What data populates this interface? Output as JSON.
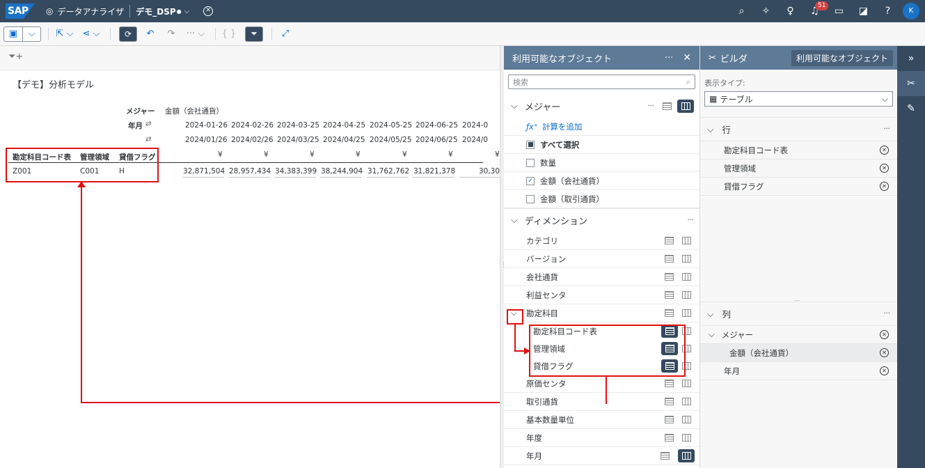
{
  "shell": {
    "app": "データアナライザ",
    "doc": "デモ_DSP",
    "notif_count": "51",
    "avatar": "K",
    "logo": "SAP"
  },
  "toolbar": {},
  "widget": {
    "title": "【デモ】分析モデル"
  },
  "table": {
    "measure_label": "メジャー",
    "measure_value": "金額（会社通貨）",
    "ym_label": "年月",
    "row_headers": [
      "勘定科目コード表",
      "管理領域",
      "貸借フラグ"
    ],
    "dates1": [
      "2024-01-26",
      "2024-02-26",
      "2024-03-25",
      "2024-04-25",
      "2024-05-25",
      "2024-06-25",
      "2024-0"
    ],
    "dates2": [
      "2024/01/26",
      "2024/02/26",
      "2024/03/25",
      "2024/04/25",
      "2024/05/25",
      "2024/06/25",
      "2024/0"
    ],
    "currency": "¥",
    "row": [
      "Z001",
      "C001",
      "H"
    ],
    "values": [
      "32,871,504",
      "28,957,434",
      "34,383,399",
      "38,244,904",
      "31,762,762",
      "31,821,378",
      "30,30"
    ]
  },
  "objects": {
    "title": "利用可能なオブジェクト",
    "search_placeholder": "検索",
    "measures_title": "メジャー",
    "add_calc": "計算を追加",
    "select_all": "すべて選択",
    "measures": [
      {
        "label": "数量",
        "checked": false
      },
      {
        "label": "金額（会社通貨）",
        "checked": true
      },
      {
        "label": "金額（取引通貨）",
        "checked": false
      }
    ],
    "dimensions_title": "ディメンション",
    "dimensions": [
      "カテゴリ",
      "バージョン",
      "会社通貨",
      "利益センタ",
      "勘定科目"
    ],
    "sub_dims": [
      "勘定科目コード表",
      "管理領域",
      "貸借フラグ"
    ],
    "dimensions2": [
      "原価センタ",
      "取引通貨",
      "基本数量単位",
      "年度",
      "年月"
    ]
  },
  "builder": {
    "title": "ビルダ",
    "objects_btn": "利用可能なオブジェクト",
    "display_type_label": "表示タイプ:",
    "display_type": "テーブル",
    "rows_title": "行",
    "rows": [
      "勘定科目コード表",
      "管理領域",
      "貸借フラグ"
    ],
    "cols_title": "列",
    "cols_measure": "メジャー",
    "cols_measure_value": "金額（会社通貨）",
    "cols_ym": "年月"
  }
}
